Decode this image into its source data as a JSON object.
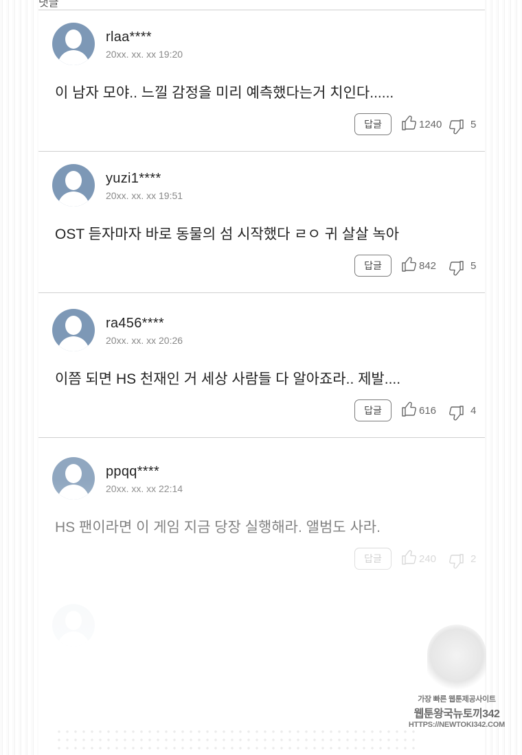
{
  "header": {
    "partial_label": "댓글"
  },
  "reply_label": "답글",
  "comments": [
    {
      "username": "rlaa****",
      "timestamp": "20xx. xx. xx  19:20",
      "text": "이 남자 모야.. 느낄 감정을 미리 예측했다는거 치인다......",
      "likes": "1240",
      "dislikes": "5"
    },
    {
      "username": "yuzi1****",
      "timestamp": "20xx. xx. xx  19:51",
      "text": "OST 듣자마자 바로 동물의 섬 시작했다 ㄹㅇ 귀 살살 녹아",
      "likes": "842",
      "dislikes": "5"
    },
    {
      "username": "ra456****",
      "timestamp": "20xx. xx. xx  20:26",
      "text": "이쯤 되면 HS 천재인 거 세상 사람들 다 알아죠라.. 제발....",
      "likes": "616",
      "dislikes": "4"
    },
    {
      "username": "ppqq****",
      "timestamp": "20xx. xx. xx  22:14",
      "text": "HS 팬이라면 이 게임 지금 당장 실행해라. 앨범도 사라.",
      "likes": "240",
      "dislikes": "2"
    }
  ],
  "watermark": {
    "line1": "가장 빠른 웹툰제공사이트",
    "line2": "웹툰왕국뉴토끼342",
    "line3": "HTTPS://NEWTOKI342.COM"
  },
  "icons": {
    "like": "thumbs-up-icon",
    "dislike": "thumbs-down-icon",
    "avatar": "user-avatar-icon"
  },
  "colors": {
    "avatar": "#7d98b6",
    "divider": "#cfcfcf",
    "count_text": "#666666"
  }
}
